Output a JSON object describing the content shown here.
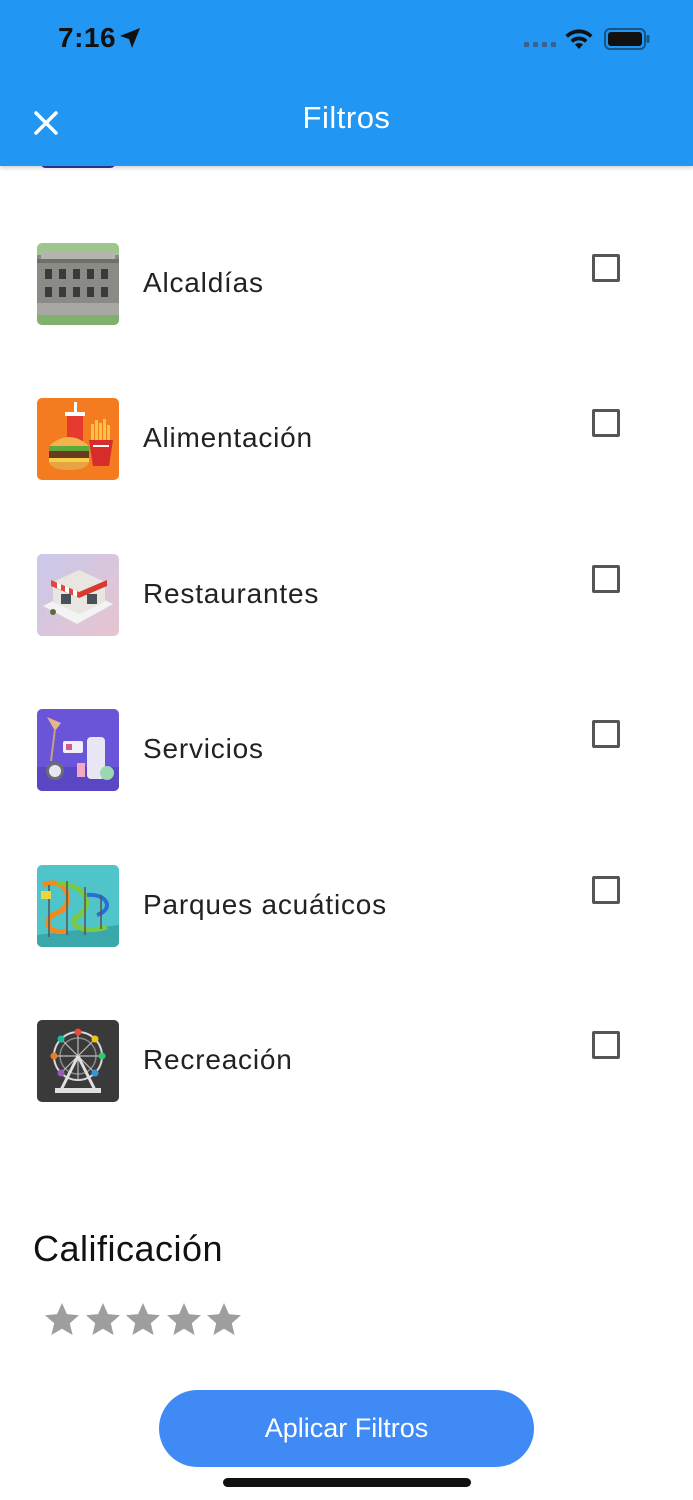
{
  "status_bar": {
    "time": "7:16"
  },
  "header": {
    "title": "Filtros",
    "close_icon": "close-icon"
  },
  "categories": [
    {
      "label": "Alcaldías",
      "checked": false,
      "icon": "city-hall-building-icon"
    },
    {
      "label": "Alimentación",
      "checked": false,
      "icon": "burger-fries-soda-icon"
    },
    {
      "label": "Restaurantes",
      "checked": false,
      "icon": "restaurant-storefront-icon"
    },
    {
      "label": "Servicios",
      "checked": false,
      "icon": "services-desk-lamp-icon"
    },
    {
      "label": "Parques acuáticos",
      "checked": false,
      "icon": "water-park-slides-icon"
    },
    {
      "label": "Recreación",
      "checked": false,
      "icon": "ferris-wheel-icon"
    }
  ],
  "rating": {
    "title": "Calificación",
    "stars_total": 5,
    "stars_selected": 0
  },
  "apply_button": {
    "label": "Aplicar Filtros"
  },
  "colors": {
    "header": "#2196F3",
    "button": "#3f8af5",
    "star_inactive": "#9e9e9e"
  }
}
